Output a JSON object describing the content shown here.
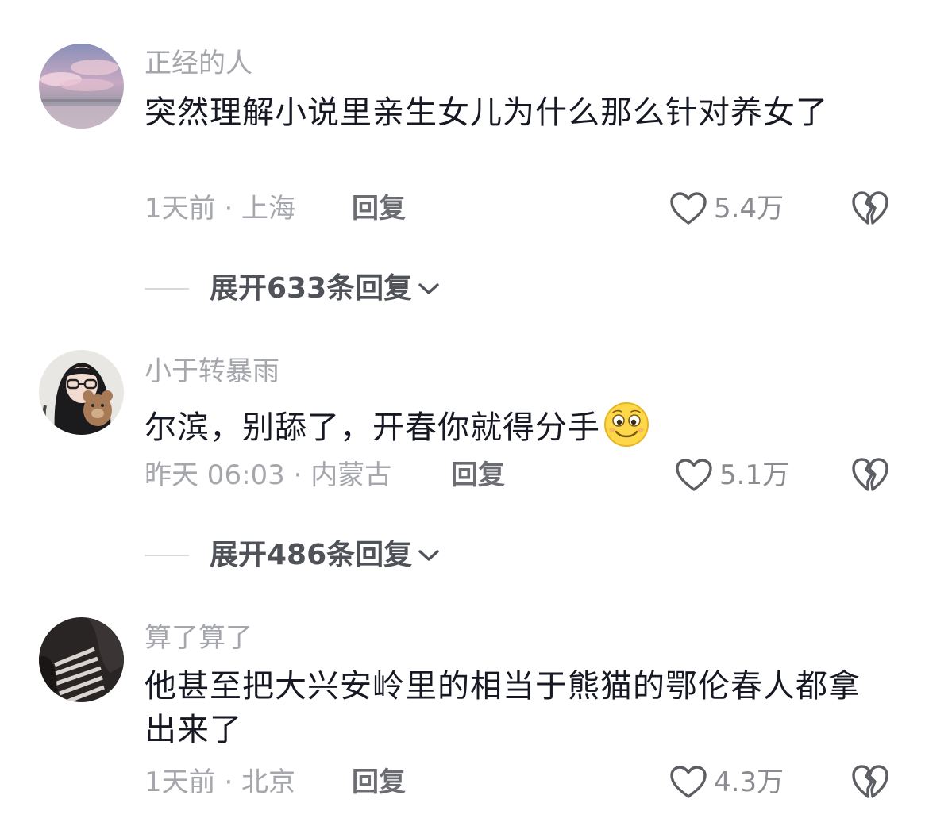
{
  "comments": [
    {
      "username": "正经的人",
      "text": "突然理解小说里亲生女儿为什么那么针对养女了",
      "time_location": "1天前 · 上海",
      "reply_label": "回复",
      "likes": "5.4万",
      "expand_label": "展开633条回复",
      "avatar": "sky-clouds-avatar"
    },
    {
      "username": "小于转暴雨",
      "text": "尔滨，别舔了，开春你就得分手",
      "emoji": "smile-emoji",
      "time_location": "昨天 06:03 · 内蒙古",
      "reply_label": "回复",
      "likes": "5.1万",
      "expand_label": "展开486条回复",
      "avatar": "girl-with-teddy-bear-avatar"
    },
    {
      "username": "算了算了",
      "text": "他甚至把大兴安岭里的相当于熊猫的鄂伦春人都拿出来了",
      "time_location": "1天前 · 北京",
      "reply_label": "回复",
      "likes": "4.3万",
      "avatar": "dark-striped-avatar"
    }
  ],
  "colors": {
    "username": "#a5a7ac",
    "body": "#161823",
    "meta": "#a5a7ac",
    "reply": "#6b6d73",
    "expand": "#505259",
    "icon": "#5c5e64"
  }
}
